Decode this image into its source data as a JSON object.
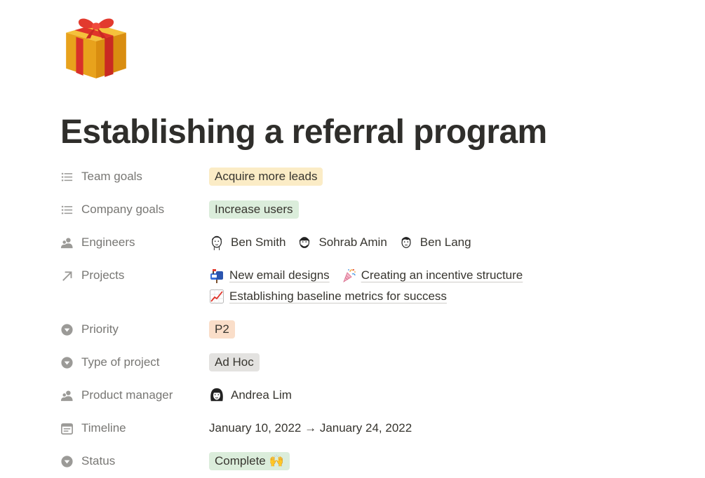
{
  "page": {
    "icon": "wrapped-gift",
    "title": "Establishing a referral program"
  },
  "properties": {
    "team_goals": {
      "label": "Team goals",
      "icon": "list-icon",
      "value": "Acquire more leads",
      "color": "#fbecc6"
    },
    "company_goals": {
      "label": "Company goals",
      "icon": "list-icon",
      "value": "Increase users",
      "color": "#dbeddb"
    },
    "engineers": {
      "label": "Engineers",
      "icon": "person-icon",
      "people": [
        {
          "name": "Ben Smith"
        },
        {
          "name": "Sohrab Amin"
        },
        {
          "name": "Ben Lang"
        }
      ]
    },
    "projects": {
      "label": "Projects",
      "icon": "arrow-up-right-icon",
      "items": [
        {
          "emoji": "mailbox",
          "name": "New email designs"
        },
        {
          "emoji": "party-popper",
          "name": "Creating an incentive structure"
        },
        {
          "emoji": "chart-increasing",
          "name": "Establishing baseline metrics for success"
        }
      ]
    },
    "priority": {
      "label": "Priority",
      "icon": "select-icon",
      "value": "P2",
      "color": "#fadec9"
    },
    "type_of_project": {
      "label": "Type of project",
      "icon": "select-icon",
      "value": "Ad Hoc",
      "color": "#e3e2e0"
    },
    "product_manager": {
      "label": "Product manager",
      "icon": "person-icon",
      "person": "Andrea Lim"
    },
    "timeline": {
      "label": "Timeline",
      "icon": "calendar-icon",
      "value": "January 10, 2022 → January 24, 2022"
    },
    "status": {
      "label": "Status",
      "icon": "select-icon",
      "value": "Complete 🙌",
      "color": "#dbeddb"
    }
  }
}
